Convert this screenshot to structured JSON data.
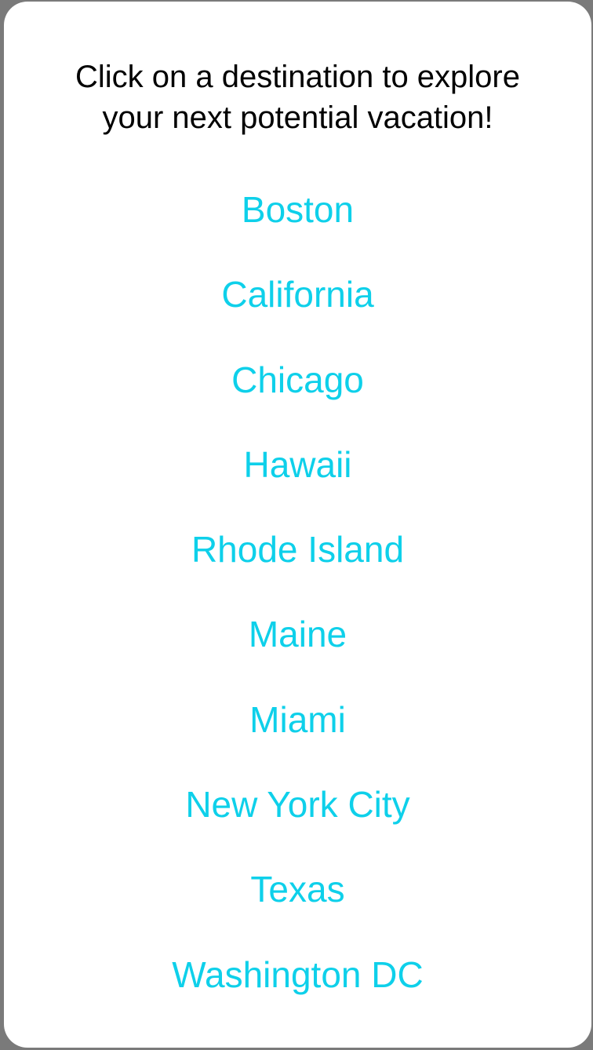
{
  "theme": {
    "link_color": "#0ed0ea",
    "text_color": "#000000"
  },
  "prompt": {
    "line1": "Click on a destination to explore",
    "line2": "your next potential vacation!"
  },
  "destinations": [
    {
      "label": "Boston"
    },
    {
      "label": "California"
    },
    {
      "label": "Chicago"
    },
    {
      "label": "Hawaii"
    },
    {
      "label": "Rhode Island"
    },
    {
      "label": "Maine"
    },
    {
      "label": "Miami"
    },
    {
      "label": "New York City"
    },
    {
      "label": "Texas"
    },
    {
      "label": "Washington DC"
    }
  ]
}
